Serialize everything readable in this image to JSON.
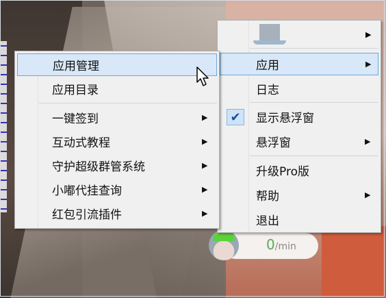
{
  "main_menu": {
    "items": [
      {
        "label": "应用",
        "has_submenu": true,
        "highlighted": true
      },
      {
        "label": "日志",
        "has_submenu": false
      },
      {
        "label": "显示悬浮窗",
        "has_submenu": false,
        "checked": true
      },
      {
        "label": "悬浮窗",
        "has_submenu": true
      },
      {
        "label": "升级Pro版",
        "has_submenu": false
      },
      {
        "label": "帮助",
        "has_submenu": true
      },
      {
        "label": "退出",
        "has_submenu": false
      }
    ],
    "check_glyph": "✔",
    "arrow_glyph": "▶"
  },
  "app_submenu": {
    "items": [
      {
        "label": "应用管理",
        "has_submenu": false,
        "highlighted": true
      },
      {
        "label": "应用目录",
        "has_submenu": false
      },
      {
        "label": "一键签到",
        "has_submenu": true
      },
      {
        "label": "互动式教程",
        "has_submenu": true
      },
      {
        "label": "守护超级群管系统",
        "has_submenu": true
      },
      {
        "label": "小嘟代挂查询",
        "has_submenu": true
      },
      {
        "label": "红包引流插件",
        "has_submenu": true
      }
    ]
  },
  "float_widget": {
    "rate_value": "0",
    "rate_unit": "/min"
  },
  "nav": {
    "prev_glyph": "‹",
    "next_glyph": "›"
  },
  "colors": {
    "highlight_bg": "#d8e8f8",
    "highlight_border": "#6aa6dd",
    "rate_green": "#5aa95a",
    "menu_bg": "#f0f0f0"
  }
}
